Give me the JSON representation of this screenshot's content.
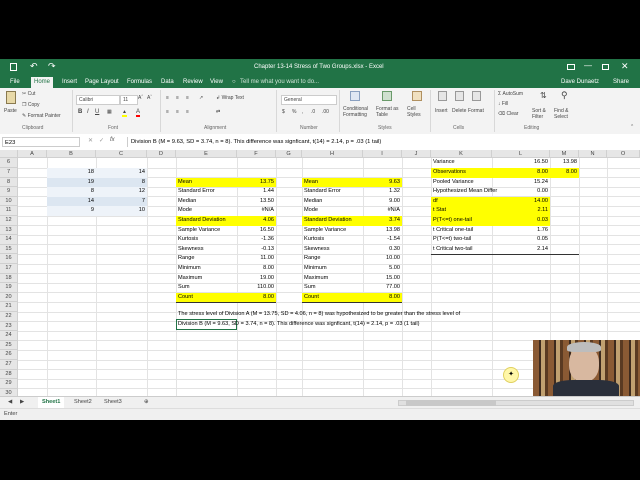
{
  "window": {
    "title": "Chapter 13-14 Stress of Two Groups.xlsx - Excel",
    "user": "Dave Dunaetz",
    "share": "Share",
    "tell_me": "Tell me what you want to do..."
  },
  "tabs": [
    "File",
    "Home",
    "Insert",
    "Page Layout",
    "Formulas",
    "Data",
    "Review",
    "View"
  ],
  "active_tab": "Home",
  "ribbon": {
    "paste": "Paste",
    "cut": "Cut",
    "copy": "Copy",
    "format_painter": "Format Painter",
    "font_name": "Calibri",
    "font_size": "11",
    "wrap_text": "Wrap Text",
    "number_format": "General",
    "conditional_formatting": "Conditional Formatting",
    "format_as_table": "Format as Table",
    "cell_styles": "Cell Styles",
    "insert": "Insert",
    "delete": "Delete",
    "format": "Format",
    "autosum": "AutoSum",
    "fill": "Fill",
    "clear": "Clear",
    "sort_filter": "Sort & Filter",
    "find_select": "Find & Select",
    "groups": [
      "Clipboard",
      "Font",
      "Alignment",
      "Number",
      "Styles",
      "Cells",
      "Editing"
    ]
  },
  "formula_bar": {
    "name_box": "E23",
    "fx": "fx",
    "content": "Division B (M = 9.63, SD = 3.74, n = 8). This difference was signficant, t(14) = 2.14, p = .03 (1 tail)"
  },
  "columns": [
    "A",
    "B",
    "C",
    "D",
    "E",
    "F",
    "G",
    "H",
    "I",
    "J",
    "K",
    "L",
    "M",
    "N",
    "O"
  ],
  "rows": [
    "6",
    "7",
    "8",
    "9",
    "10",
    "11",
    "12",
    "13",
    "14",
    "15",
    "16",
    "17",
    "18",
    "19",
    "20",
    "21",
    "22",
    "23",
    "24",
    "25",
    "26",
    "27",
    "28",
    "29",
    "30"
  ],
  "cells": {
    "bc": [
      [
        "18",
        "14"
      ],
      [
        "19",
        "8"
      ],
      [
        "8",
        "12"
      ],
      [
        "14",
        "7"
      ],
      [
        "9",
        "10"
      ]
    ],
    "desc1": [
      [
        "Mean",
        "13.75"
      ],
      [
        "Standard Error",
        "1.44"
      ],
      [
        "Median",
        "13.50"
      ],
      [
        "Mode",
        "#N/A"
      ],
      [
        "Standard Deviation",
        "4.06"
      ],
      [
        "Sample Variance",
        "16.50"
      ],
      [
        "Kurtosis",
        "-1.36"
      ],
      [
        "Skewness",
        "-0.13"
      ],
      [
        "Range",
        "11.00"
      ],
      [
        "Minimum",
        "8.00"
      ],
      [
        "Maximum",
        "19.00"
      ],
      [
        "Sum",
        "110.00"
      ],
      [
        "Count",
        "8.00"
      ]
    ],
    "desc2": [
      [
        "Mean",
        "9.63"
      ],
      [
        "Standard Error",
        "1.32"
      ],
      [
        "Median",
        "9.00"
      ],
      [
        "Mode",
        "#N/A"
      ],
      [
        "Standard Deviation",
        "3.74"
      ],
      [
        "Sample Variance",
        "13.98"
      ],
      [
        "Kurtosis",
        "-1.54"
      ],
      [
        "Skewness",
        "0.30"
      ],
      [
        "Range",
        "10.00"
      ],
      [
        "Minimum",
        "5.00"
      ],
      [
        "Maximum",
        "15.00"
      ],
      [
        "Sum",
        "77.00"
      ],
      [
        "Count",
        "8.00"
      ]
    ],
    "ttest": [
      [
        "Variance",
        "16.50",
        "13.98"
      ],
      [
        "Observations",
        "8.00",
        "8.00"
      ],
      [
        "Pooled Variance",
        "15.24",
        ""
      ],
      [
        "Hypothesized Mean Differ",
        "0.00",
        ""
      ],
      [
        "df",
        "14.00",
        ""
      ],
      [
        "t Stat",
        "2.11",
        ""
      ],
      [
        "P(T<=t) one-tail",
        "0.03",
        ""
      ],
      [
        "t Critical one-tail",
        "1.76",
        ""
      ],
      [
        "P(T<=t) two-tail",
        "0.05",
        ""
      ],
      [
        "t Critical two-tail",
        "2.14",
        ""
      ]
    ],
    "summary_line1": "The stress level of Division A (M = 13.75, SD = 4.06, n = 8) was hypothesized to be greater than the stress level of",
    "summary_line2": "Division B (M = 9.63, SD = 3.74, n = 8). This difference was signficant, t(14) = 2.14, p  = .03 (1 tail)"
  },
  "sheets": [
    "Sheet1",
    "Sheet2",
    "Sheet3"
  ],
  "active_sheet": "Sheet1",
  "status": "Enter",
  "colors": {
    "excel_green": "#217346",
    "highlight": "#ffff00",
    "ribbon_bg": "#f3f3f3"
  }
}
